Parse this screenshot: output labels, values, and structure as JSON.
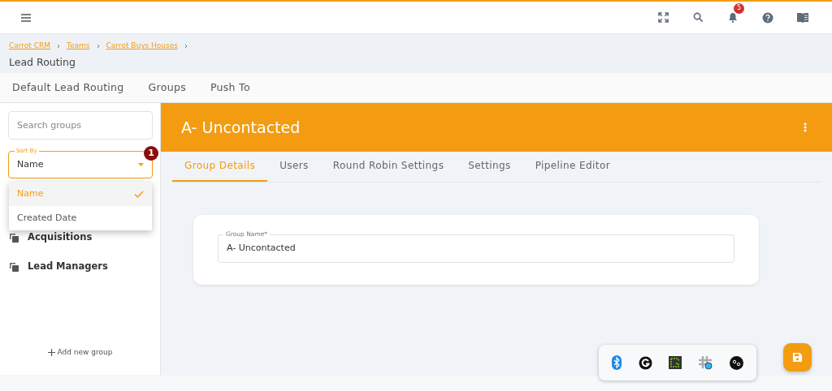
{
  "topbar": {
    "notification_count": "5"
  },
  "breadcrumbs": [
    "Carrot CRM",
    "Teams",
    "Carrot Buys Houses"
  ],
  "page_title": "Lead Routing",
  "page_tabs": [
    "Default Lead Routing",
    "Groups",
    "Push To"
  ],
  "sidebar": {
    "search": {
      "placeholder": "Search groups"
    },
    "sort": {
      "label": "Sort By",
      "value": "Name",
      "step": "1",
      "expanded": true,
      "options": [
        {
          "label": "Name",
          "selected": true
        },
        {
          "label": "Created Date",
          "selected": false
        }
      ]
    },
    "groups": [
      {
        "name": "Acquisitions"
      },
      {
        "name": "Lead Managers"
      }
    ],
    "add_button": "Add new group"
  },
  "group": {
    "title": "A- Uncontacted",
    "tabs": [
      {
        "label": "Group Details",
        "selected": true
      },
      {
        "label": "Users",
        "selected": false
      },
      {
        "label": "Round Robin Settings",
        "selected": false
      },
      {
        "label": "Settings",
        "selected": false
      },
      {
        "label": "Pipeline Editor",
        "selected": false
      }
    ],
    "field": {
      "label": "Group Name*",
      "value": "A- Uncontacted"
    }
  },
  "dock": [
    {
      "kind": "bluetooth"
    },
    {
      "kind": "grammarly"
    },
    {
      "kind": "terminal"
    },
    {
      "kind": "slack"
    },
    {
      "kind": "bo"
    }
  ]
}
